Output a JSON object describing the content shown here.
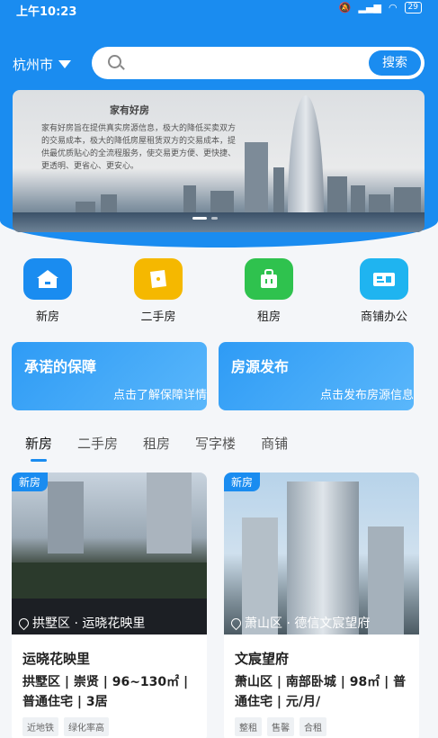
{
  "status": {
    "time": "上午10:23",
    "battery": "29"
  },
  "header": {
    "city": "杭州市",
    "search_placeholder": "",
    "search_button": "搜索"
  },
  "banner": {
    "title": "家有好房",
    "text": "家有好房旨在提供真实房源信息，极大的降低买卖双方的交易成本，极大的降低房屋租赁双方的交易成本，提供最优质贴心的全流程服务，使交易更方便、更快捷、更透明、更省心、更安心。"
  },
  "categories": [
    {
      "label": "新房",
      "icon": "house-icon",
      "color": "#1a8cf0"
    },
    {
      "label": "二手房",
      "icon": "box-icon",
      "color": "#f5b800"
    },
    {
      "label": "租房",
      "icon": "bag-icon",
      "color": "#2fc24e"
    },
    {
      "label": "商铺办公",
      "icon": "office-icon",
      "color": "#1fb4f0"
    }
  ],
  "promos": [
    {
      "title": "承诺的保障",
      "subtitle": "点击了解保障详情"
    },
    {
      "title": "房源发布",
      "subtitle": "点击发布房源信息"
    }
  ],
  "tabs": [
    "新房",
    "二手房",
    "租房",
    "写字楼",
    "商铺"
  ],
  "cards": [
    {
      "badge": "新房",
      "location": "拱墅区 · 运晓花映里",
      "name": "运晓花映里",
      "info": "拱墅区 | 崇贤 | 96~130㎡ | 普通住宅 | 3居",
      "tags": [
        "近地铁",
        "绿化率高"
      ]
    },
    {
      "badge": "新房",
      "location": "萧山区 · 德信文宸望府",
      "name": "文宸望府",
      "info": "萧山区 | 南部卧城 | 98㎡ | 普通住宅 | 元/月/",
      "tags": [
        "整租",
        "售馨",
        "合租"
      ]
    }
  ]
}
